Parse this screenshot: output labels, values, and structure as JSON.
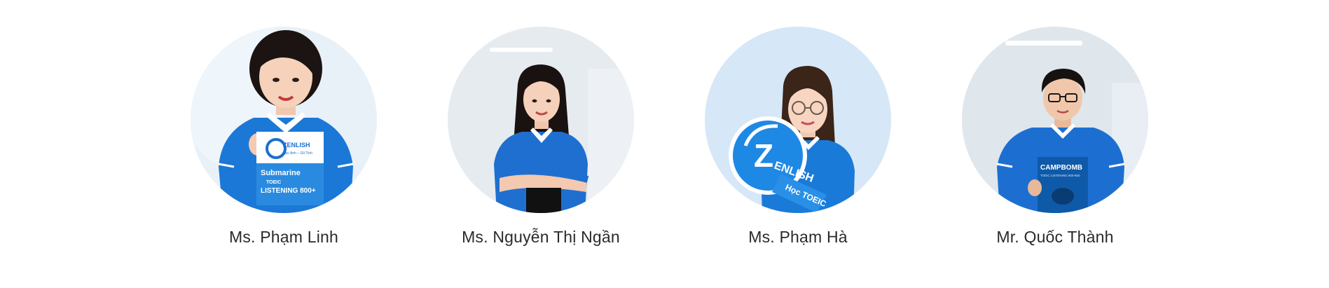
{
  "team": {
    "members": [
      {
        "name": "Ms. Phạm Linh",
        "bg_color": "#e6f0f8",
        "shirt_color": "#1b78d6",
        "prop": "book",
        "book": {
          "brand": "ZENLISH",
          "tagline": "Học Anh – Gõ Tinh",
          "title1": "Submarine",
          "title2": "TOEIC",
          "title3": "LISTENING 800+"
        }
      },
      {
        "name": "Ms. Nguyễn Thị Ngần",
        "bg_color": "#e4e9ef",
        "shirt_color": "#1f6fd0",
        "prop": "none"
      },
      {
        "name": "Ms. Phạm Hà",
        "bg_color": "#d5e6f6",
        "shirt_color": "#1a7ad8",
        "prop": "sign",
        "sign": {
          "letter": "Z",
          "brand": "ENLISH",
          "ribbon": "Học TOEIC"
        }
      },
      {
        "name": "Mr. Quốc Thành",
        "bg_color": "#dfe6ec",
        "shirt_color": "#1c6fd1",
        "prop": "book2",
        "book": {
          "title1": "CAMPBOMB",
          "title2": "TOEIC LISTENING 800-850"
        }
      }
    ]
  }
}
